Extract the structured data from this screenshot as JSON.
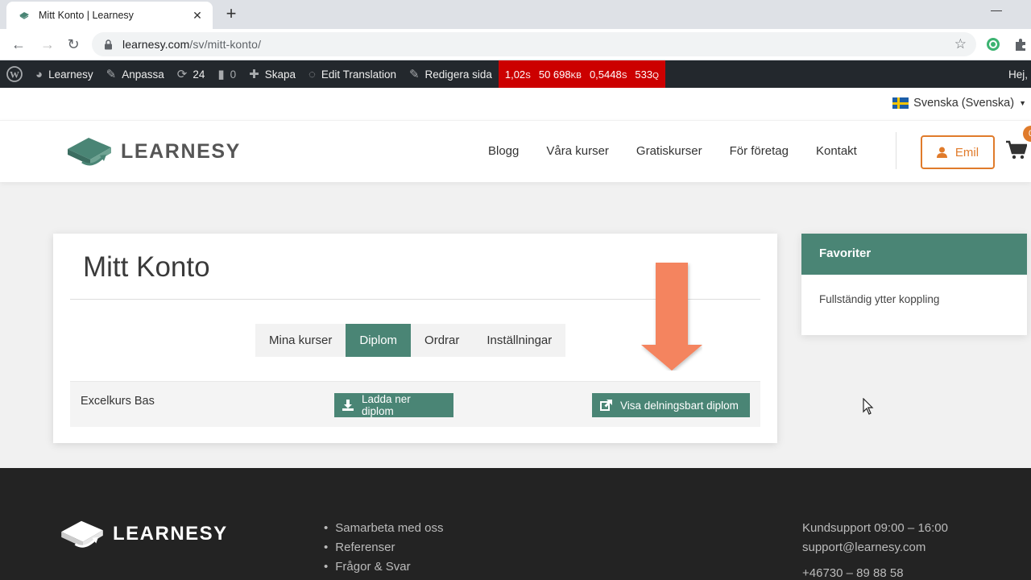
{
  "browser": {
    "tab_title": "Mitt Konto | Learnesy",
    "url_host": "learnesy.com",
    "url_path": "/sv/mitt-konto/"
  },
  "adminbar": {
    "site": "Learnesy",
    "customize": "Anpassa",
    "updates": "24",
    "comments": "0",
    "create": "Skapa",
    "edit_translation": "Edit Translation",
    "edit_page": "Redigera sida",
    "perf": {
      "time": "1,02",
      "time_unit": "S",
      "memory": "50 698",
      "memory_unit": "KB",
      "query_time": "0,5448",
      "query_time_unit": "S",
      "queries": "533",
      "queries_unit": "Q"
    },
    "greeting": "Hej,"
  },
  "language": {
    "label": "Svenska (Svenska)"
  },
  "header": {
    "logo_text": "LEARNESY",
    "nav": [
      "Blogg",
      "Våra kurser",
      "Gratiskurser",
      "För företag",
      "Kontakt"
    ],
    "user": "Emil",
    "cart_count": "0"
  },
  "account": {
    "title": "Mitt Konto",
    "tabs": [
      "Mina kurser",
      "Diplom",
      "Ordrar",
      "Inställningar"
    ],
    "active_tab": "Diplom",
    "rows": [
      {
        "course": "Excelkurs Bas",
        "download_label": "Ladda ner diplom",
        "share_label": "Visa delningsbart diplom"
      }
    ]
  },
  "sidebar": {
    "title": "Favoriter",
    "text": "Fullständig ytter koppling"
  },
  "footer": {
    "logo_text": "LEARNESY",
    "links": [
      "Samarbeta med oss",
      "Referenser",
      "Frågor & Svar"
    ],
    "support_hours": "Kundsupport 09:00 – 16:00",
    "email": "support@learnesy.com",
    "phone": "+46730 – 89 88 58"
  },
  "colors": {
    "brand_green": "#4a8575",
    "accent_orange": "#e07b2b",
    "adminbar": "#23282d",
    "perf_red": "#cc0000",
    "annotation_arrow": "#f4845f"
  }
}
